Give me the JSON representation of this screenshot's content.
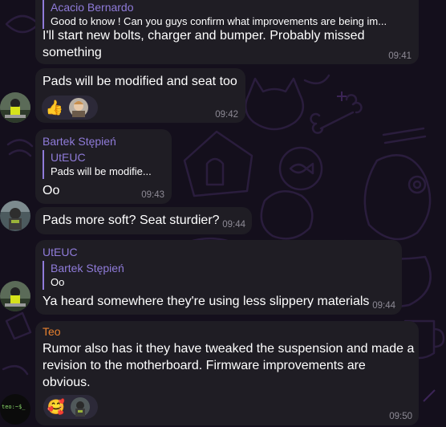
{
  "messages": [
    {
      "reply_name": "Acacio Bernardo",
      "reply_text": "Good to know ! Can you guys confirm what improvements are being im...",
      "text_line1": "I'll start new bolts, charger and bumper.  Probably missed",
      "text_line2": "something",
      "time": "09:41"
    },
    {
      "text": "Pads will be modified and seat too",
      "time": "09:42",
      "reactions": [
        "thumbs-up",
        "user-avatar"
      ]
    },
    {
      "author": "Bartek Stępień",
      "reply_name": "UtEUC",
      "reply_text": "Pads will be modifie...",
      "text": "Oo",
      "time": "09:43"
    },
    {
      "text": "Pads more soft? Seat sturdier?",
      "time": "09:44"
    },
    {
      "author": "UtEUC",
      "reply_name": "Bartek Stępień",
      "reply_text": "Oo",
      "text": "Ya heard somewhere they're using less slippery materials",
      "time": "09:44"
    },
    {
      "author": "Teo",
      "text_line1": "Rumor also has it they have tweaked the suspension and made a",
      "text_line2": "revision to the motherboard. Firmware improvements are",
      "text_line3": "obvious.",
      "time": "09:50",
      "reactions": [
        "heart-face",
        "user-avatar"
      ]
    }
  ],
  "avatars": {
    "last_label": "teo:~$_"
  },
  "colors": {
    "background": "#140f1c",
    "bubble": "#1f1d24",
    "accent_violet": "#8f7bd9",
    "accent_orange": "#e8812f",
    "meta": "#8d8a95"
  }
}
